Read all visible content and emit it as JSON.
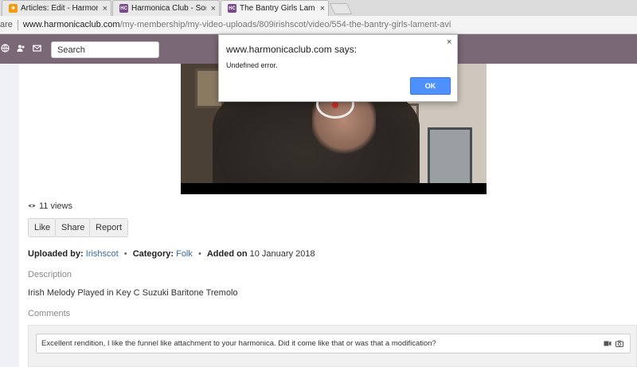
{
  "browser": {
    "tabs": [
      {
        "title": "Articles: Edit - Harmonica",
        "favicon": "joomla-icon",
        "color": "#f39c12"
      },
      {
        "title": "Harmonica Club - Songs",
        "favicon": "hc-icon",
        "color": "#7b4a8c"
      },
      {
        "title": "The Bantry Girls Lament",
        "favicon": "hc-icon",
        "color": "#7b4a8c"
      }
    ],
    "address_left": "are",
    "url_host": "www.harmonicaclub.com",
    "url_path": "/my-membership/my-video-uploads/809irishscot/video/554-the-bantry-girls-lament-avi"
  },
  "site": {
    "bar_color": "#7b6877",
    "icons": [
      "globe-icon",
      "users-icon",
      "mail-icon"
    ],
    "search_placeholder": "Search"
  },
  "video": {
    "views_text": "11 views"
  },
  "actions": {
    "like": "Like",
    "share": "Share",
    "report": "Report"
  },
  "meta": {
    "uploaded_by_label": "Uploaded by:",
    "uploader": "Irishscot",
    "category_label": "Category:",
    "category": "Folk",
    "added_label": "Added on",
    "added_date": "10 January 2018"
  },
  "description": {
    "label": "Description",
    "text": "Irish Melody Played in Key C Suzuki Baritone Tremolo"
  },
  "comments": {
    "label": "Comments",
    "draft": "Excellent rendition, I like the funnel like attachment to your harmonica. Did it come like that or was that a modification?"
  },
  "dialog": {
    "title": "www.harmonicaclub.com says:",
    "message": "Undefined error.",
    "ok": "OK"
  }
}
